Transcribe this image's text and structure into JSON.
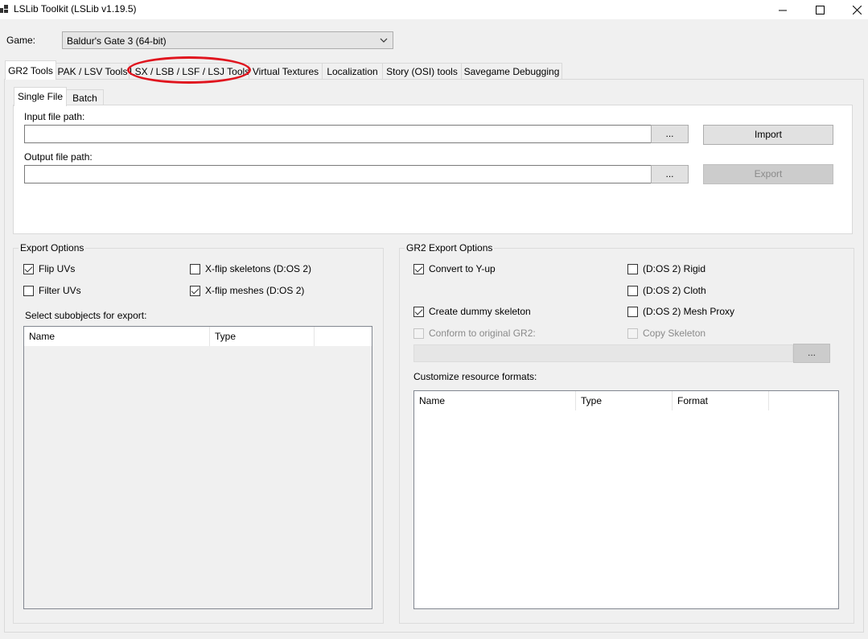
{
  "window": {
    "title": "LSLib Toolkit (LSLib v1.19.5)",
    "controls": {
      "minimize": "─",
      "maximize": "☐",
      "close": "✕"
    }
  },
  "game": {
    "label": "Game:",
    "selected": "Baldur's Gate 3 (64-bit)"
  },
  "main_tabs": [
    {
      "label": "GR2 Tools",
      "active": true
    },
    {
      "label": "PAK / LSV Tools"
    },
    {
      "label": "LSX / LSB / LSF / LSJ Tools",
      "highlighted": true
    },
    {
      "label": "Virtual Textures"
    },
    {
      "label": "Localization"
    },
    {
      "label": "Story (OSI) tools"
    },
    {
      "label": "Savegame Debugging"
    }
  ],
  "sub_tabs": [
    {
      "label": "Single File",
      "active": true
    },
    {
      "label": "Batch"
    }
  ],
  "single_file": {
    "input_label": "Input file path:",
    "input_value": "",
    "output_label": "Output file path:",
    "output_value": "",
    "browse_label": "...",
    "import_label": "Import",
    "export_label": "Export"
  },
  "export_options": {
    "title": "Export Options",
    "flip_uvs": "Flip UVs",
    "filter_uvs": "Filter UVs",
    "xflip_skeletons": "X-flip skeletons (D:OS 2)",
    "xflip_meshes": "X-flip meshes (D:OS 2)",
    "subobjects_label": "Select subobjects for export:",
    "columns": [
      "Name",
      "Type"
    ]
  },
  "gr2_export_options": {
    "title": "GR2 Export Options",
    "convert_y_up": "Convert to Y-up",
    "rigid": "(D:OS 2) Rigid",
    "cloth": "(D:OS 2) Cloth",
    "create_dummy": "Create dummy skeleton",
    "mesh_proxy": "(D:OS 2) Mesh Proxy",
    "conform": "Conform to original GR2:",
    "copy_skeleton": "Copy Skeleton",
    "browse_label": "...",
    "customize_label": "Customize resource formats:",
    "columns": [
      "Name",
      "Type",
      "Format"
    ]
  },
  "colors": {
    "highlight_ring": "#e0141e",
    "window_bg": "#f0f0f0"
  }
}
